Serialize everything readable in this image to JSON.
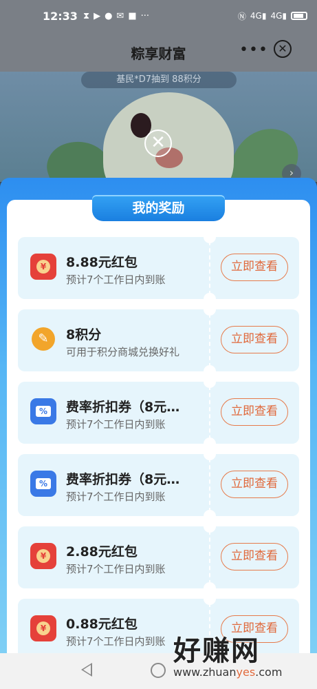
{
  "status_bar": {
    "time": "12:33",
    "left_icons": [
      "hourglass-icon",
      "play-icon",
      "wechat-icon",
      "mail-icon",
      "taobao-icon",
      "more-dots-icon"
    ],
    "right_icons": [
      "nfc-icon",
      "signal-4g-icon",
      "signal-4g-icon",
      "battery-icon"
    ],
    "network_label_1": "4G",
    "network_label_2": "4G"
  },
  "title_bar": {
    "title": "粽享财富",
    "more_label": "•••",
    "close_label": "✕"
  },
  "background": {
    "ticker": "基民*D7抽到 88积分"
  },
  "dialog": {
    "dismiss_label": "✕",
    "heading": "我的奖励"
  },
  "rewards": [
    {
      "icon": "red-packet-icon",
      "title": "8.88元红包",
      "subtitle": "预计7个工作日内到账",
      "button": "立即查看"
    },
    {
      "icon": "points-coin-icon",
      "title": "8积分",
      "subtitle": "可用于积分商城兑换好礼",
      "button": "立即查看"
    },
    {
      "icon": "discount-coupon-icon",
      "title": "费率折扣券（8元…",
      "subtitle": "预计7个工作日内到账",
      "button": "立即查看"
    },
    {
      "icon": "discount-coupon-icon",
      "title": "费率折扣券（8元…",
      "subtitle": "预计7个工作日内到账",
      "button": "立即查看"
    },
    {
      "icon": "red-packet-icon",
      "title": "2.88元红包",
      "subtitle": "预计7个工作日内到账",
      "button": "立即查看"
    },
    {
      "icon": "red-packet-icon",
      "title": "0.88元红包",
      "subtitle": "预计7个工作日内到账",
      "button": "立即查看"
    }
  ],
  "watermark": {
    "big": "好赚网",
    "small_a": "www.zhuan",
    "small_b": "yes",
    "small_c": ".com"
  },
  "colors": {
    "accent_button": "#e0683a",
    "panel_blue": "#2d8ef0",
    "item_bg": "#e6f5fc"
  }
}
